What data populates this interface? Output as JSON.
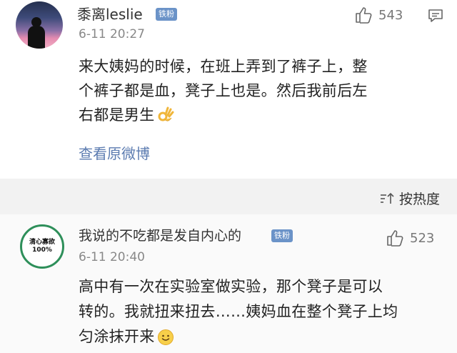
{
  "comment1": {
    "username": "黍离leslie",
    "badge": "铁粉",
    "time": "6-11 20:27",
    "likes": "543",
    "content_lines": [
      "来大姨妈的时候，在班上弄到了裤子上，整",
      "个裤子都是血，凳子上也是。然后我前后左",
      "右都是男生"
    ],
    "view_original": "查看原微博"
  },
  "sort": {
    "label": "按热度"
  },
  "comment2": {
    "username": "我说的不吃都是发自内心的",
    "badge": "铁粉",
    "time": "6-11 20:40",
    "likes": "523",
    "avatar_text_1": "清心寡欲",
    "avatar_text_2": "100%",
    "content_lines": [
      "高中有一次在实验室做实验，那个凳子是可以",
      "转的。我就扭来扭去……姨妈血在整个凳子上均",
      "匀涂抹开来"
    ]
  },
  "colors": {
    "badge": "#6b93c8",
    "link": "#5b7bb0",
    "sortbar": "#f2f2f2"
  }
}
